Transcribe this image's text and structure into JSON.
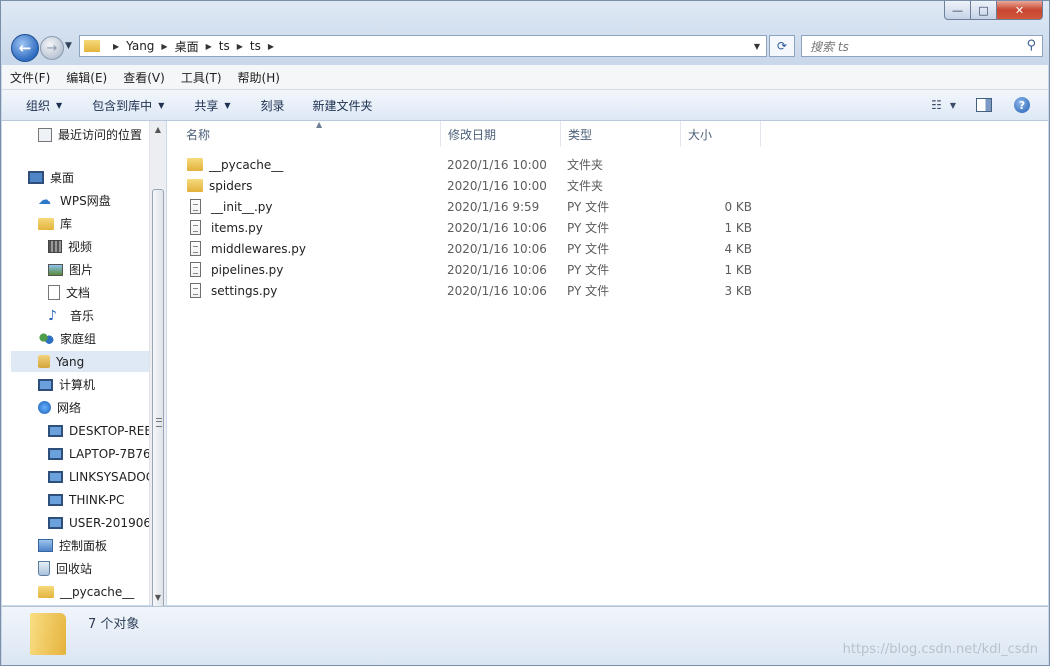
{
  "window": {
    "minimize": "—",
    "maximize": "□",
    "close": "✕"
  },
  "address": {
    "crumbs": [
      "Yang",
      "桌面",
      "ts",
      "ts"
    ]
  },
  "search": {
    "placeholder": "搜索 ts"
  },
  "menubar": [
    "文件(F)",
    "编辑(E)",
    "查看(V)",
    "工具(T)",
    "帮助(H)"
  ],
  "commands": [
    {
      "label": "组织",
      "dropdown": true
    },
    {
      "label": "包含到库中",
      "dropdown": true
    },
    {
      "label": "共享",
      "dropdown": true
    },
    {
      "label": "刻录",
      "dropdown": false
    },
    {
      "label": "新建文件夹",
      "dropdown": false
    }
  ],
  "nav": [
    {
      "label": "最近访问的位置",
      "icon": "recent-places-icon",
      "indent": 0
    },
    {
      "label": "桌面",
      "icon": "desktop-icon",
      "indent": 0
    },
    {
      "label": "WPS网盘",
      "icon": "cloud-icon",
      "indent": 1
    },
    {
      "label": "库",
      "icon": "library-icon",
      "indent": 1
    },
    {
      "label": "视频",
      "icon": "video-icon",
      "indent": 2
    },
    {
      "label": "图片",
      "icon": "picture-icon",
      "indent": 2
    },
    {
      "label": "文档",
      "icon": "document-icon",
      "indent": 2
    },
    {
      "label": "音乐",
      "icon": "music-icon",
      "indent": 2
    },
    {
      "label": "家庭组",
      "icon": "homegroup-icon",
      "indent": 1
    },
    {
      "label": "Yang",
      "icon": "user-folder-icon",
      "indent": 1,
      "selected": true
    },
    {
      "label": "计算机",
      "icon": "computer-icon",
      "indent": 1
    },
    {
      "label": "网络",
      "icon": "network-icon",
      "indent": 1
    },
    {
      "label": "DESKTOP-REE",
      "icon": "network-computer-icon",
      "indent": 2
    },
    {
      "label": "LAPTOP-7B76",
      "icon": "network-computer-icon",
      "indent": 2
    },
    {
      "label": "LINKSYSADOC",
      "icon": "network-computer-icon",
      "indent": 2
    },
    {
      "label": "THINK-PC",
      "icon": "network-computer-icon",
      "indent": 2
    },
    {
      "label": "USER-201906",
      "icon": "network-computer-icon",
      "indent": 2
    },
    {
      "label": "控制面板",
      "icon": "control-panel-icon",
      "indent": 1
    },
    {
      "label": "回收站",
      "icon": "recycle-bin-icon",
      "indent": 1
    },
    {
      "label": "__pycache__",
      "icon": "folder-icon",
      "indent": 1
    }
  ],
  "columns": {
    "name": "名称",
    "date": "修改日期",
    "type": "类型",
    "size": "大小"
  },
  "files": [
    {
      "name": "__pycache__",
      "date": "2020/1/16 10:00",
      "type": "文件夹",
      "size": "",
      "kind": "folder"
    },
    {
      "name": "spiders",
      "date": "2020/1/16 10:00",
      "type": "文件夹",
      "size": "",
      "kind": "folder"
    },
    {
      "name": "__init__.py",
      "date": "2020/1/16 9:59",
      "type": "PY 文件",
      "size": "0 KB",
      "kind": "py"
    },
    {
      "name": "items.py",
      "date": "2020/1/16 10:06",
      "type": "PY 文件",
      "size": "1 KB",
      "kind": "py"
    },
    {
      "name": "middlewares.py",
      "date": "2020/1/16 10:06",
      "type": "PY 文件",
      "size": "4 KB",
      "kind": "py"
    },
    {
      "name": "pipelines.py",
      "date": "2020/1/16 10:06",
      "type": "PY 文件",
      "size": "1 KB",
      "kind": "py"
    },
    {
      "name": "settings.py",
      "date": "2020/1/16 10:06",
      "type": "PY 文件",
      "size": "3 KB",
      "kind": "py"
    }
  ],
  "status": {
    "count": "7 个对象"
  },
  "watermark": "https://blog.csdn.net/kdl_csdn"
}
